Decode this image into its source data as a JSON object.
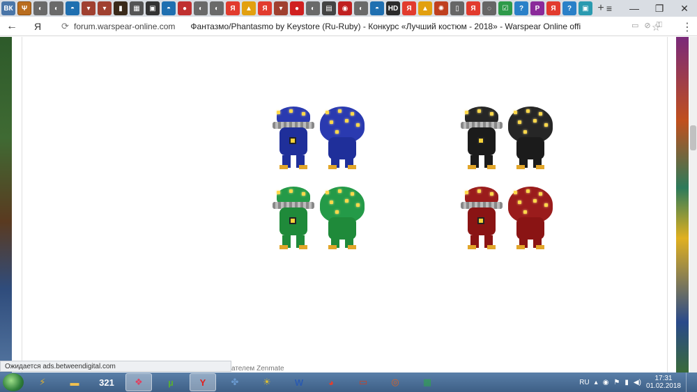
{
  "tabs": [
    {
      "glyph": "ВК",
      "color": "#4a76a8"
    },
    {
      "glyph": "Ψ",
      "color": "#b96d1f",
      "active": true
    },
    {
      "glyph": "◐",
      "color": "#6a6a6a"
    },
    {
      "glyph": "◐",
      "color": "#6a6a6a"
    },
    {
      "glyph": "◓",
      "color": "#1f6fb0"
    },
    {
      "glyph": "▾",
      "color": "#a04030"
    },
    {
      "glyph": "▾",
      "color": "#a04030"
    },
    {
      "glyph": "▮",
      "color": "#3a2a1a"
    },
    {
      "glyph": "▦",
      "color": "#555555"
    },
    {
      "glyph": "▣",
      "color": "#333333"
    },
    {
      "glyph": "◓",
      "color": "#1f6fb0"
    },
    {
      "glyph": "●",
      "color": "#c03030"
    },
    {
      "glyph": "◐",
      "color": "#6a6a6a"
    },
    {
      "glyph": "◐",
      "color": "#6a6a6a"
    },
    {
      "glyph": "Я",
      "color": "#e23b2e"
    },
    {
      "glyph": "▲",
      "color": "#e2a010"
    },
    {
      "glyph": "Я",
      "color": "#e23b2e"
    },
    {
      "glyph": "▾",
      "color": "#a04030"
    },
    {
      "glyph": "●",
      "color": "#d02020"
    },
    {
      "glyph": "◐",
      "color": "#6a6a6a"
    },
    {
      "glyph": "▤",
      "color": "#444444"
    },
    {
      "glyph": "◉",
      "color": "#c02020"
    },
    {
      "glyph": "◐",
      "color": "#6a6a6a"
    },
    {
      "glyph": "◓",
      "color": "#1f6fb0"
    },
    {
      "glyph": "HD",
      "color": "#2b2b2b"
    },
    {
      "glyph": "Я",
      "color": "#e23b2e"
    },
    {
      "glyph": "▲",
      "color": "#e2a010"
    },
    {
      "glyph": "✺",
      "color": "#c04020"
    },
    {
      "glyph": "▯",
      "color": "#666666"
    },
    {
      "glyph": "Я",
      "color": "#e23b2e"
    },
    {
      "glyph": "◌",
      "color": "#666666"
    },
    {
      "glyph": "☑",
      "color": "#2e9a4a"
    },
    {
      "glyph": "?",
      "color": "#2a80c8"
    },
    {
      "glyph": "P",
      "color": "#8a2a9a"
    },
    {
      "glyph": "Я",
      "color": "#e23b2e"
    },
    {
      "glyph": "?",
      "color": "#2a80c8"
    },
    {
      "glyph": "▣",
      "color": "#2a9ab0"
    }
  ],
  "new_tab": "+",
  "window_controls": {
    "menu": "≡",
    "minimize": "—",
    "restore": "❐",
    "close": "✕"
  },
  "address": {
    "back": "←",
    "yandex": "Я",
    "domain": "forum.warspear-online.com",
    "title": "Фантазмо/Phantasmo by Keystore (Ru-Ruby) - Конкурс «Лучший костюм - 2018» - Warspear Online official f...",
    "bookmark": "☆",
    "menu": "⋮"
  },
  "sprites": [
    {
      "color": "#1f2f9a",
      "hat": "#2a3ab0",
      "type": "hood"
    },
    {
      "color": "#1f2f9a",
      "hat": "#2a3ab0",
      "type": "bulb"
    },
    {
      "color": "#1b1b1b",
      "hat": "#262626",
      "type": "hood"
    },
    {
      "color": "#1b1b1b",
      "hat": "#262626",
      "type": "bulb"
    },
    {
      "color": "#1f8a3a",
      "hat": "#249a48",
      "type": "hood"
    },
    {
      "color": "#1f8a3a",
      "hat": "#249a48",
      "type": "bulb"
    },
    {
      "color": "#8a1414",
      "hat": "#9a1c1c",
      "type": "hood"
    },
    {
      "color": "#8a1414",
      "hat": "#9a1c1c",
      "type": "bulb"
    }
  ],
  "status_text": "Ожидается ads.betweendigital.com",
  "footer_text": "ателем Zenmate",
  "taskbar": {
    "apps": [
      {
        "glyph": "⚡",
        "color": "#e0b030"
      },
      {
        "glyph": "▬",
        "color": "#f0c050"
      },
      {
        "glyph": "321",
        "color": "#ffffff"
      },
      {
        "glyph": "❖",
        "color": "#e04060",
        "active": true
      },
      {
        "glyph": "µ",
        "color": "#5ab030"
      },
      {
        "glyph": "Y",
        "color": "#e02020",
        "active": true
      },
      {
        "glyph": "✤",
        "color": "#6a9ad0"
      },
      {
        "glyph": "☀",
        "color": "#e0c030"
      },
      {
        "glyph": "W",
        "color": "#2a5ab0"
      },
      {
        "glyph": "◕",
        "color": "#e04030"
      },
      {
        "glyph": "▭",
        "color": "#d04020"
      },
      {
        "glyph": "◎",
        "color": "#e06020"
      },
      {
        "glyph": "▦",
        "color": "#30a050"
      }
    ],
    "lang": "RU",
    "time": "17:31",
    "date": "01.02.2018"
  }
}
